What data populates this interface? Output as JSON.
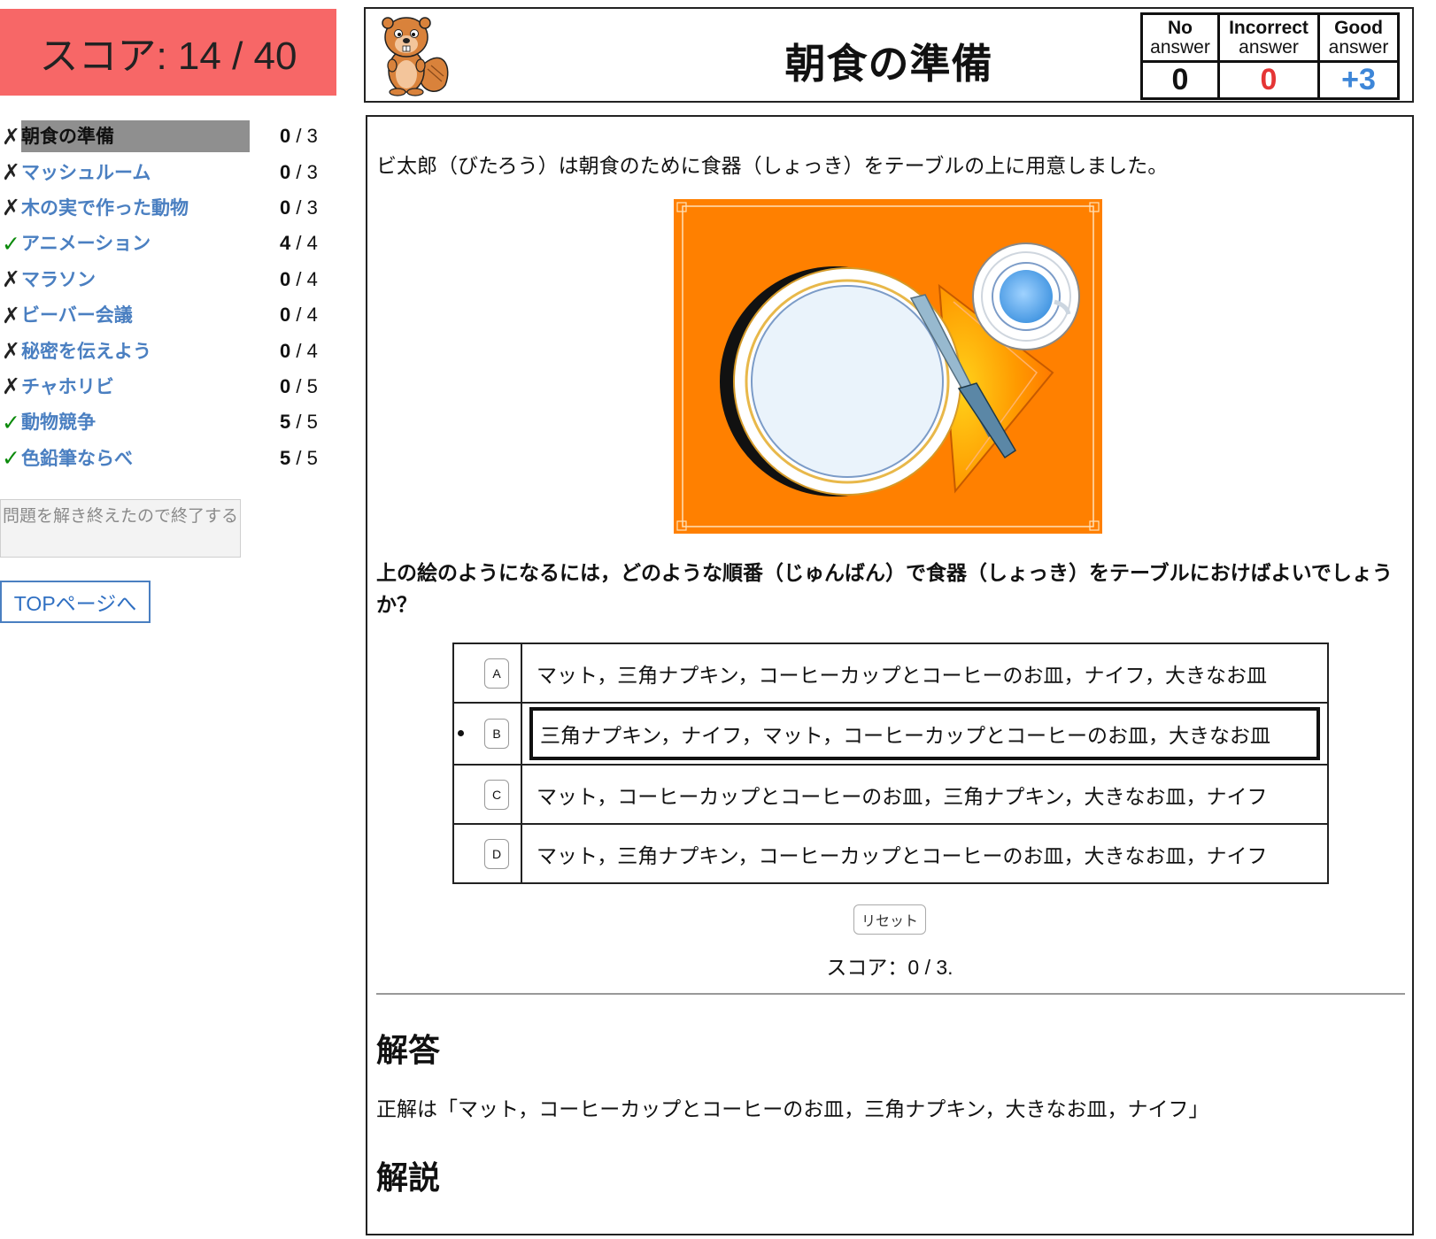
{
  "sidebar": {
    "score_label": "スコア: 14 / 40",
    "tasks": [
      {
        "mark": "✗",
        "status": "incorrect",
        "name": "朝食の準備",
        "score": "0",
        "max": " / 3",
        "current": true
      },
      {
        "mark": "✗",
        "status": "incorrect",
        "name": "マッシュルーム",
        "score": "0",
        "max": " / 3"
      },
      {
        "mark": "✗",
        "status": "incorrect",
        "name": "木の実で作った動物",
        "score": "0",
        "max": " / 3"
      },
      {
        "mark": "✓",
        "status": "correct",
        "name": "アニメーション",
        "score": "4",
        "max": " / 4"
      },
      {
        "mark": "✗",
        "status": "incorrect",
        "name": "マラソン",
        "score": "0",
        "max": " / 4"
      },
      {
        "mark": "✗",
        "status": "incorrect",
        "name": "ビーバー会議",
        "score": "0",
        "max": " / 4"
      },
      {
        "mark": "✗",
        "status": "incorrect",
        "name": "秘密を伝えよう",
        "score": "0",
        "max": " / 4"
      },
      {
        "mark": "✗",
        "status": "incorrect",
        "name": "チャホリビ",
        "score": "0",
        "max": " / 5"
      },
      {
        "mark": "✓",
        "status": "correct",
        "name": "動物競争",
        "score": "5",
        "max": " / 5"
      },
      {
        "mark": "✓",
        "status": "correct",
        "name": "色鉛筆ならべ",
        "score": "5",
        "max": " / 5"
      }
    ],
    "finish_button": "問題を解き終えたので終了する",
    "top_link": "TOPページへ"
  },
  "header": {
    "title": "朝食の準備",
    "score_headers": [
      {
        "line1": "No",
        "line2": "answer"
      },
      {
        "line1": "Incorrect",
        "line2": "answer"
      },
      {
        "line1": "Good",
        "line2": "answer"
      }
    ],
    "score_values": [
      "0",
      "0",
      "+3"
    ]
  },
  "main": {
    "intro": "ビ太郎（びたろう）は朝食のために食器（しょっき）をテーブルの上に用意しました。",
    "question": "上の絵のようになるには，どのような順番（じゅんばん）で食器（しょっき）をテーブルにおけばよいでしょうか？",
    "choices": [
      {
        "key": "A",
        "text": "マット，三角ナプキン，コーヒーカップとコーヒーのお皿，ナイフ，大きなお皿"
      },
      {
        "key": "B",
        "text": "三角ナプキン，ナイフ，マット，コーヒーカップとコーヒーのお皿，大きなお皿",
        "selected": true
      },
      {
        "key": "C",
        "text": "マット，コーヒーカップとコーヒーのお皿，三角ナプキン，大きなお皿，ナイフ"
      },
      {
        "key": "D",
        "text": "マット，三角ナプキン，コーヒーカップとコーヒーのお皿，大きなお皿，ナイフ"
      }
    ],
    "reset_button": "リセット",
    "task_score": "スコア：0 / 3.",
    "answer_heading": "解答",
    "answer_text": "正解は「マット，コーヒーカップとコーヒーのお皿，三角ナプキン，大きなお皿，ナイフ」",
    "explanation_heading": "解説"
  },
  "colors": {
    "score_box_bg": "#f76767",
    "link_blue": "#4a7fc1",
    "check_green": "#0b8a0b",
    "incorrect_red": "#e53535",
    "good_blue": "#3d86d8",
    "mat_orange": "#ff8000"
  },
  "icons": {
    "mascot": "beaver-mascot-icon",
    "correct": "check-mark-icon",
    "incorrect": "cross-mark-icon"
  }
}
